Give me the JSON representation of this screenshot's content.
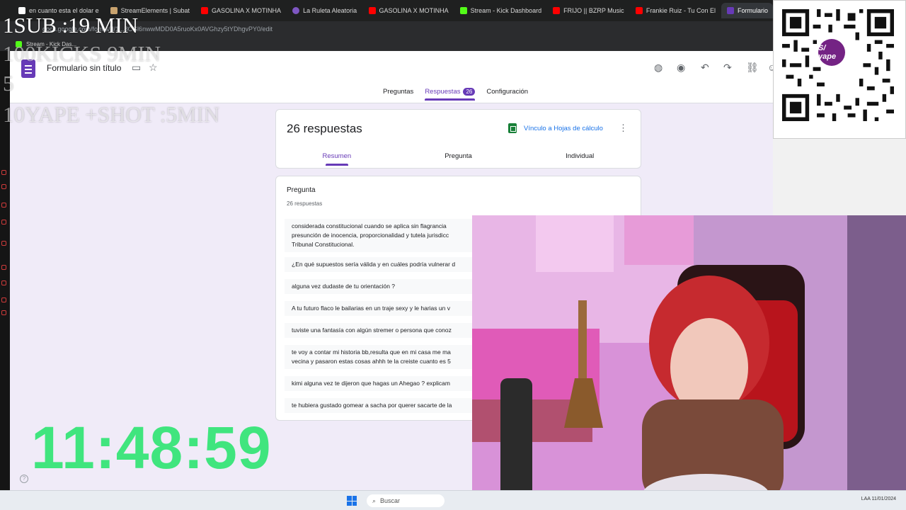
{
  "browser": {
    "tabs": [
      {
        "label": "en cuanto esta el dolar e",
        "color": "#ffffff"
      },
      {
        "label": "StreamElements | Subat",
        "color": "#c9a36e"
      },
      {
        "label": "GASOLINA X MOTINHA",
        "color": "#ff0000"
      },
      {
        "label": "La Ruleta Aleatoria",
        "color": "#7e57c2"
      },
      {
        "label": "GASOLINA X MOTINHA",
        "color": "#ff0000"
      },
      {
        "label": "Stream - Kick Dashboard",
        "color": "#53fc18"
      },
      {
        "label": "FRIJO || BZRP Music",
        "color": "#ff0000"
      },
      {
        "label": "Frankie Ruiz - Tu Con El",
        "color": "#ff0000"
      },
      {
        "label": "Formulario",
        "color": "#673ab7"
      }
    ],
    "address": "docs.google.com/forms/d/1...8CGl6nwwMDD0A5ruoKx0AVGhzy5tYDhgvPY0/edit",
    "bookmark": "Stream - Kick Das..."
  },
  "form": {
    "title": "Formulario sin título",
    "tabs": {
      "preguntas": "Preguntas",
      "respuestas": "Respuestas",
      "respuestas_count": "26",
      "configuracion": "Configuración"
    },
    "summary": {
      "title": "26 respuestas",
      "sheets_link": "Vínculo a Hojas de cálculo",
      "subtabs": [
        "Resumen",
        "Pregunta",
        "Individual"
      ]
    },
    "question": {
      "title": "Pregunta",
      "count": "26 respuestas",
      "answers": [
        "considerada constitucional cuando se aplica sin flagrancia",
        "presunción de inocencia, proporcionalidad y tutela jurisdicc",
        "Tribunal Constitucional.",
        "¿En qué supuestos sería válida y en cuáles podría vulnerar d",
        "alguna vez dudaste de tu orientación ?",
        "A tu futuro flaco le bailarias en un traje sexy y le harias un v",
        "tuviste una fantasía con algún stremer o persona que conoz",
        "te voy a contar mi historia bb,resulta que en mi casa me ma",
        "vecina y pasaron estas cosas ahhh te la creiste cuanto es 5",
        "kimi alguna vez te dijeron que hagas un Ahegao ? explicam",
        "te hubiera gustado gomear a sacha por querer sacarte de la"
      ]
    }
  },
  "overlay": {
    "lines": [
      "1SUB :19 MIN",
      "100KICKS 9MIN",
      "5",
      "10YAPE +SHOT :5MIN"
    ],
    "timer": "11:48:59",
    "qr_brand": "S/ yape"
  },
  "taskbar": {
    "search_placeholder": "Buscar",
    "tray": "LAA  11/01/2024"
  },
  "colors": {
    "forms_accent": "#673ab7",
    "timer_green": "#40e57e",
    "link_blue": "#1a73e8"
  }
}
